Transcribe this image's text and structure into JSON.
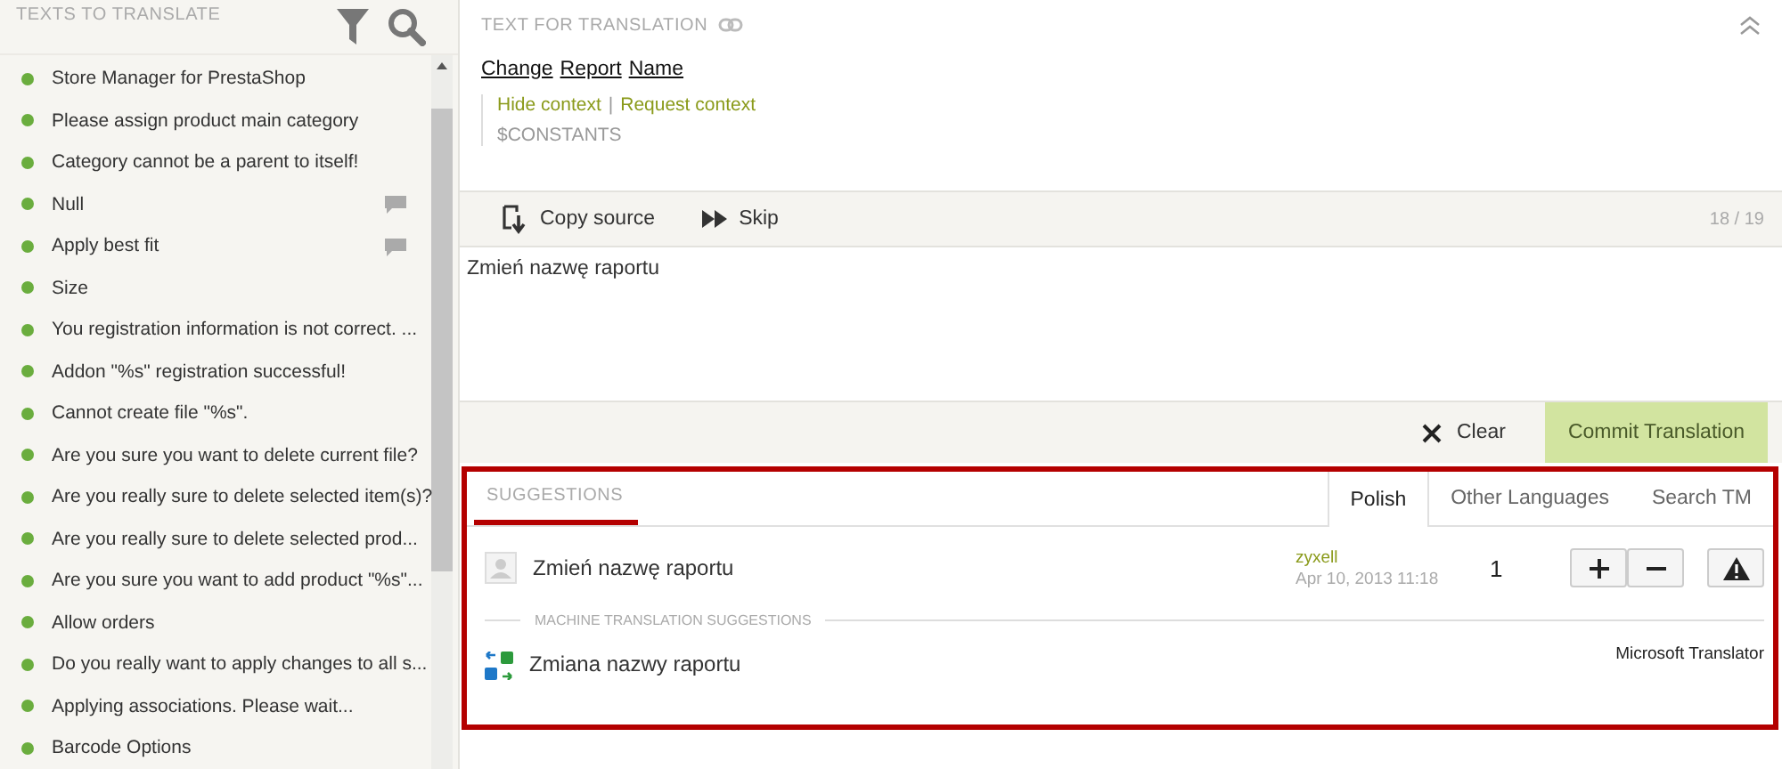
{
  "sidebar": {
    "title": "TEXTS TO TRANSLATE",
    "items": [
      {
        "label": "Store Manager for PrestaShop",
        "has_comment": false
      },
      {
        "label": "Please assign product main category",
        "has_comment": false
      },
      {
        "label": "Category cannot be a parent to itself!",
        "has_comment": false
      },
      {
        "label": "Null",
        "has_comment": true
      },
      {
        "label": "Apply best fit",
        "has_comment": true
      },
      {
        "label": "Size",
        "has_comment": false
      },
      {
        "label": "You registration information is not correct. ...",
        "has_comment": false
      },
      {
        "label": "Addon \"%s\" registration successful!",
        "has_comment": false
      },
      {
        "label": "Cannot create file \"%s\".",
        "has_comment": false
      },
      {
        "label": "Are you sure you want to delete current file?",
        "has_comment": false
      },
      {
        "label": "Are you really sure to delete selected item(s)?",
        "has_comment": false
      },
      {
        "label": "Are you really sure to delete selected prod...",
        "has_comment": false
      },
      {
        "label": "Are you sure you want to add product \"%s\"...",
        "has_comment": false
      },
      {
        "label": "Allow orders",
        "has_comment": false
      },
      {
        "label": "Do you really want to apply changes to all s...",
        "has_comment": false
      },
      {
        "label": "Applying associations. Please wait...",
        "has_comment": false
      },
      {
        "label": "Barcode Options",
        "has_comment": false
      }
    ]
  },
  "source": {
    "title": "TEXT FOR TRANSLATION",
    "words": [
      "Change",
      "Report",
      "Name"
    ],
    "hide_context": "Hide context",
    "separator": "|",
    "request_context": "Request context",
    "context": "$CONSTANTS"
  },
  "toolbar": {
    "copy_source": "Copy source",
    "skip": "Skip",
    "counter": "18 / 19"
  },
  "translation": {
    "value": "Zmień nazwę raportu"
  },
  "actions": {
    "clear": "Clear",
    "commit": "Commit Translation"
  },
  "suggestions": {
    "title": "SUGGESTIONS",
    "tabs": [
      {
        "label": "Polish",
        "selected": true
      },
      {
        "label": "Other Languages",
        "selected": false
      },
      {
        "label": "Search TM",
        "selected": false
      }
    ],
    "items": [
      {
        "text": "Zmień nazwę raportu",
        "user": "zyxell",
        "date": "Apr 10, 2013 11:18",
        "votes": "1"
      }
    ],
    "machine_title": "MACHINE TRANSLATION SUGGESTIONS",
    "machine": [
      {
        "text": "Zmiana nazwy raportu",
        "provider": "Microsoft Translator"
      }
    ]
  }
}
